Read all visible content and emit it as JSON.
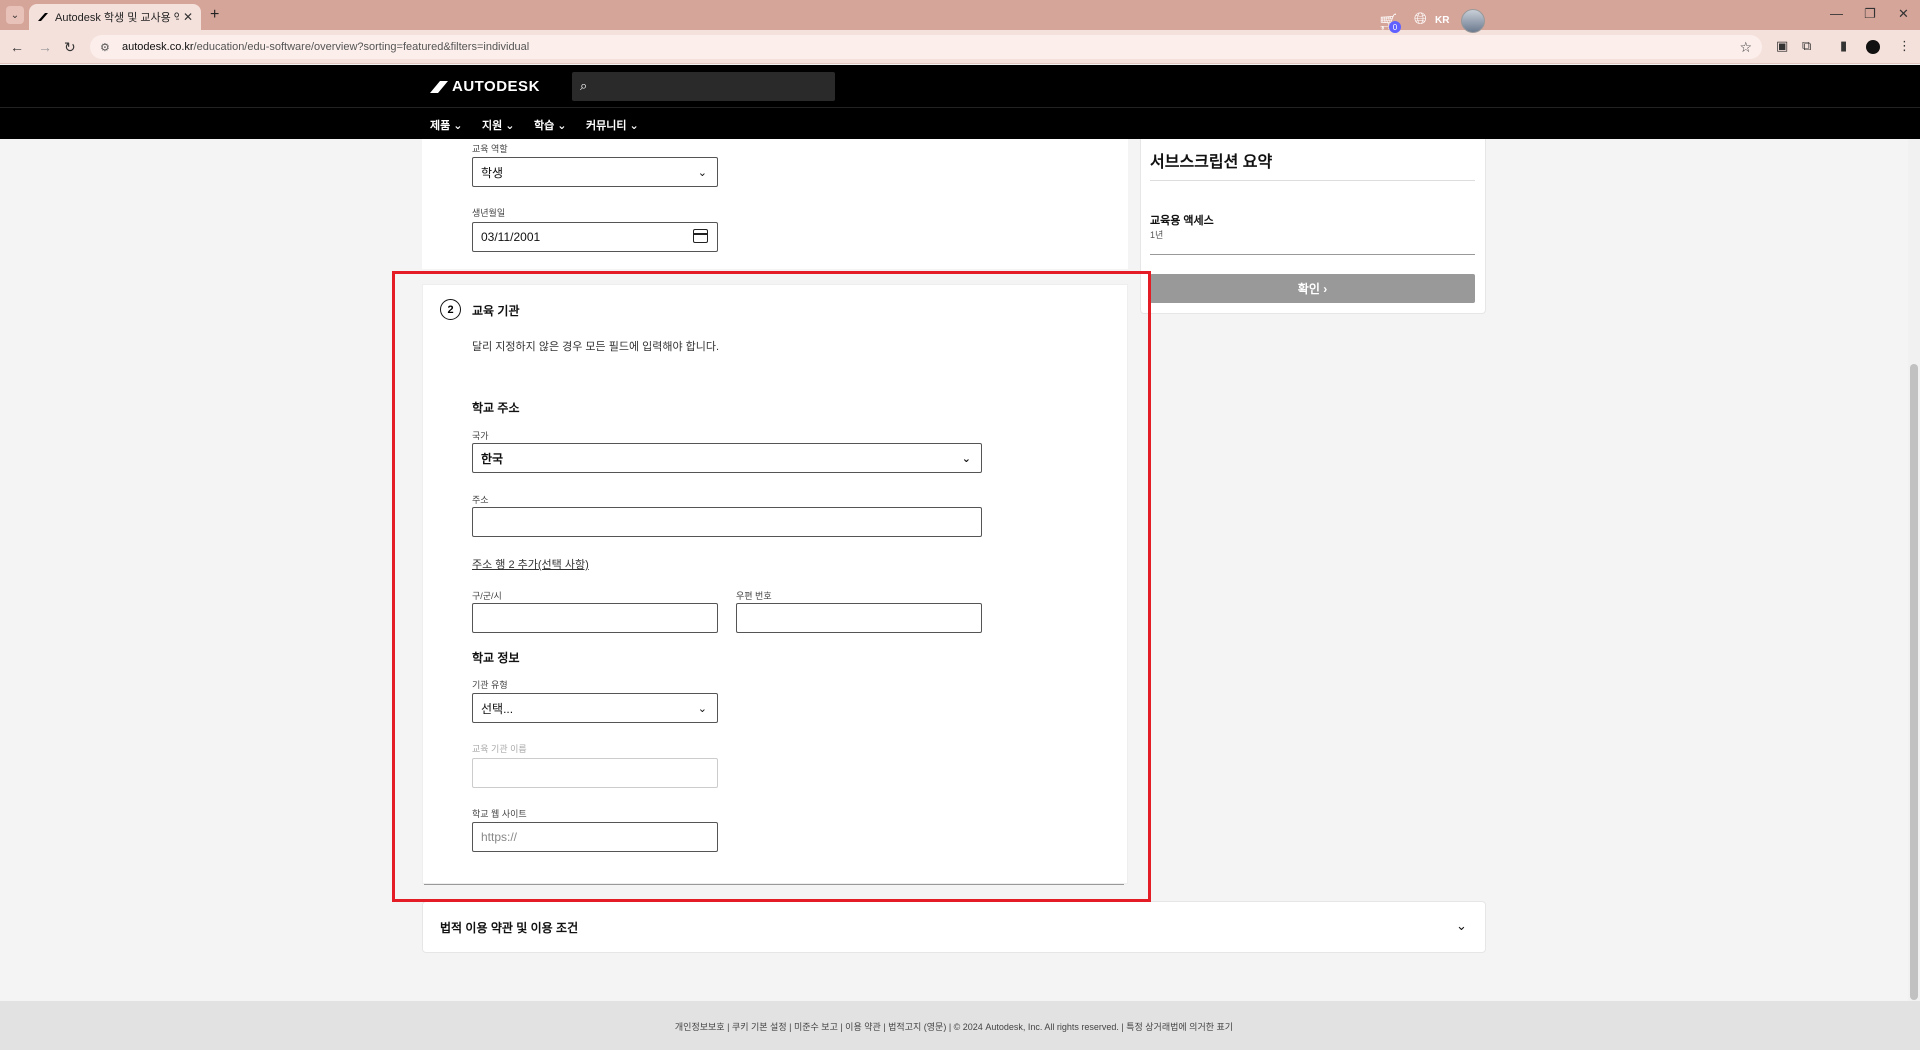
{
  "browser": {
    "tab_title": "Autodesk 학생 및 교사용 액세",
    "url_host": "autodesk.co.kr",
    "url_path": "/education/edu-software/overview?sorting=featured&filters=individual"
  },
  "header": {
    "logo": "AUTODESK",
    "cart_count": "0",
    "lang": "KR",
    "nav": [
      "제품",
      "지원",
      "학습",
      "커뮤니티"
    ]
  },
  "form_top": {
    "role_label": "교육 역할",
    "role_value": "학생",
    "dob_label": "생년월일",
    "dob_value": "03/11/2001"
  },
  "institution": {
    "step": "2",
    "title": "교육 기관",
    "notice": "달리 지정하지 않은 경우 모든 필드에 입력해야 합니다.",
    "address_heading": "학교 주소",
    "country_label": "국가",
    "country_value": "한국",
    "address_label": "주소",
    "address_value": "",
    "add_line2": "주소 행 2 추가(선택 사항)",
    "city_label": "구/군/시",
    "city_value": "",
    "postal_label": "우편 번호",
    "postal_value": "",
    "info_heading": "학교 정보",
    "type_label": "기관 유형",
    "type_value": "선택...",
    "name_label": "교육 기관 이름",
    "name_value": "",
    "website_label": "학교 웹 사이트",
    "website_placeholder": "https://"
  },
  "summary": {
    "title": "서브스크립션 요약",
    "item": "교육용 액세스",
    "term": "1년",
    "confirm": "확인"
  },
  "legal": {
    "title": "법적 이용 약관 및 이용 조건"
  },
  "footer": {
    "text": "개인정보보호 | 쿠키 기본 설정 | 미준수 보고 | 이용 약관 | 법적고지 (영문) | © 2024 Autodesk, Inc. All rights reserved. | 특정 상거래법에 의거한 표기"
  },
  "colors": {
    "highlight_frame": "#e31c25",
    "tab_strip": "#d6a59a",
    "confirm_button": "#999999",
    "cart_badge": "#5f60ff"
  }
}
